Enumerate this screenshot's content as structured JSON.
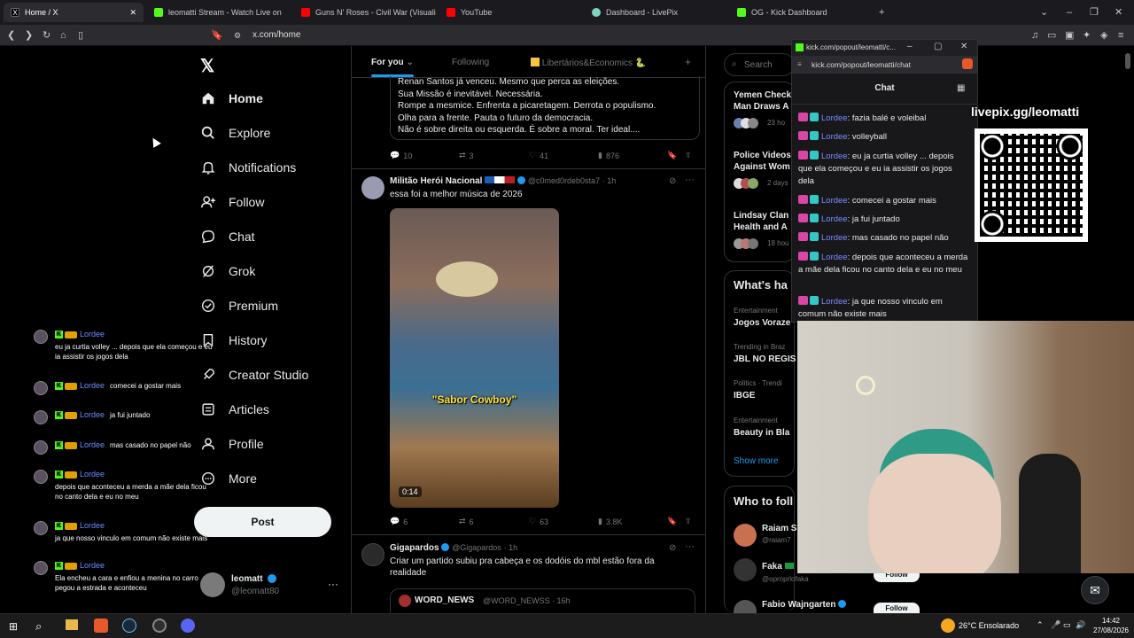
{
  "browser": {
    "tabs": [
      {
        "title": "Home / X",
        "color": "#000000"
      },
      {
        "title": "leomatti Stream - Watch Live on",
        "color": "#53fc18"
      },
      {
        "title": "Guns N' Roses - Civil War (Visuali",
        "color": "#ff0000"
      },
      {
        "title": "YouTube",
        "color": "#ff0000"
      },
      {
        "title": "Dashboard - LivePix",
        "color": "#7fd3c0"
      },
      {
        "title": "OG - Kick Dashboard",
        "color": "#53fc18"
      }
    ],
    "url": "x.com/home"
  },
  "popup": {
    "url": "kick.com/popout/leomatti/c...",
    "address": "kick.com/popout/leomatti/chat",
    "chat_title": "Chat",
    "messages": [
      {
        "user": "Lordee",
        "text": ": fazia balé e voleibal"
      },
      {
        "user": "Lordee",
        "text": ": volleyball"
      },
      {
        "user": "Lordee",
        "text": ": eu ja curtia volley ... depois que ela começou e eu ia assistir os jogos dela"
      },
      {
        "user": "Lordee",
        "text": ": comecei a gostar mais"
      },
      {
        "user": "Lordee",
        "text": ": ja fui juntado"
      },
      {
        "user": "Lordee",
        "text": ": mas casado no papel não"
      },
      {
        "user": "Lordee",
        "text": ": depois que aconteceu a merda a mãe dela ficou no canto dela e eu no meu"
      },
      {
        "user": "Lordee",
        "text": ": ja que nosso vinculo em comum não existe mais"
      }
    ]
  },
  "overlay": {
    "livepix": "livepix.gg/leomatti",
    "chat": [
      {
        "user": "Lordee",
        "text": "eu ja curtia volley ... depois que ela começou e eu ia assistir os jogos dela"
      },
      {
        "user": "Lordee",
        "text": "comecei a gostar mais"
      },
      {
        "user": "Lordee",
        "text": "ja fui juntado"
      },
      {
        "user": "Lordee",
        "text": "mas casado no papel não"
      },
      {
        "user": "Lordee",
        "text": "depois que aconteceu a merda a mãe dela ficou no canto dela e eu no meu"
      },
      {
        "user": "Lordee",
        "text": "ja que nosso vinculo em comum não existe mais"
      },
      {
        "user": "Lordee",
        "text": "Ela encheu a cara e enfiou a menina no carro pegou a estrada e aconteceu"
      }
    ]
  },
  "nav": {
    "items": [
      "Home",
      "Explore",
      "Notifications",
      "Follow",
      "Chat",
      "Grok",
      "Premium",
      "History",
      "Creator Studio",
      "Articles",
      "Profile",
      "More"
    ],
    "post": "Post",
    "user_name": "leomatt",
    "user_handle": "@leomatt80"
  },
  "feed": {
    "tabs": [
      "For you",
      "Following",
      "Libertários&Economics"
    ],
    "tweet1": {
      "lines": [
        "Renan Santos já venceu. Mesmo que perca as eleições.",
        "Sua Missão é inevitável. Necessária.",
        "Rompe a mesmice. Enfrenta a picaretagem. Derrota o populismo.",
        "Olha para a frente. Pauta o futuro da democracia.",
        "Não é sobre direita ou esquerda. É sobre a moral. Ter ideal...."
      ],
      "replies": "10",
      "reposts": "3",
      "likes": "41",
      "views": "876"
    },
    "tweet2": {
      "name": "Militão Herói Nacional",
      "handle": "@c0med0rdeb0sta7",
      "time": "· 1h",
      "text": "essa foi a melhor música de 2026",
      "caption": "\"Sabor Cowboy\"",
      "duration": "0:14",
      "replies": "6",
      "reposts": "6",
      "likes": "63",
      "views": "3.8K"
    },
    "tweet3": {
      "name": "Gigapardos",
      "handle": "@Gigapardos",
      "time": "· 1h",
      "text": "Criar um partido subiu pra cabeça e os dodóis do mbl estão fora da realidade",
      "quote_name": "WORD_NEWS",
      "quote_handle": "@WORD_NEWSS",
      "quote_time": "· 16h"
    }
  },
  "right": {
    "search": "Search",
    "news": [
      {
        "title": "Yemen Check Man Draws A",
        "meta": "23 ho"
      },
      {
        "title": "Police Videos Against Wom",
        "meta": "2 days"
      },
      {
        "title": "Lindsay Clan Health and A",
        "meta": "18 hou"
      }
    ],
    "whats_happening": "What's ha",
    "trends": [
      {
        "ctx": "Entertainment",
        "name": "Jogos Voraze"
      },
      {
        "ctx": "Trending in Braz",
        "name": "JBL NO REGIS"
      },
      {
        "ctx": "Politics · Trendi",
        "name": "IBGE"
      },
      {
        "ctx": "Entertainment",
        "name": "Beauty in Bla"
      }
    ],
    "show_more": "Show more",
    "who_to_follow": "Who to foll",
    "follows": [
      {
        "name": "Raiam S",
        "handle": "@raiam7"
      },
      {
        "name": "Faka",
        "handle": "@oproprlofaka"
      },
      {
        "name": "Fabio Wajngarten",
        "handle": ""
      }
    ],
    "follow_label": "Follow"
  },
  "taskbar": {
    "weather": "26°C Ensolarado",
    "time": "14:42",
    "date": "27/08/2026"
  }
}
